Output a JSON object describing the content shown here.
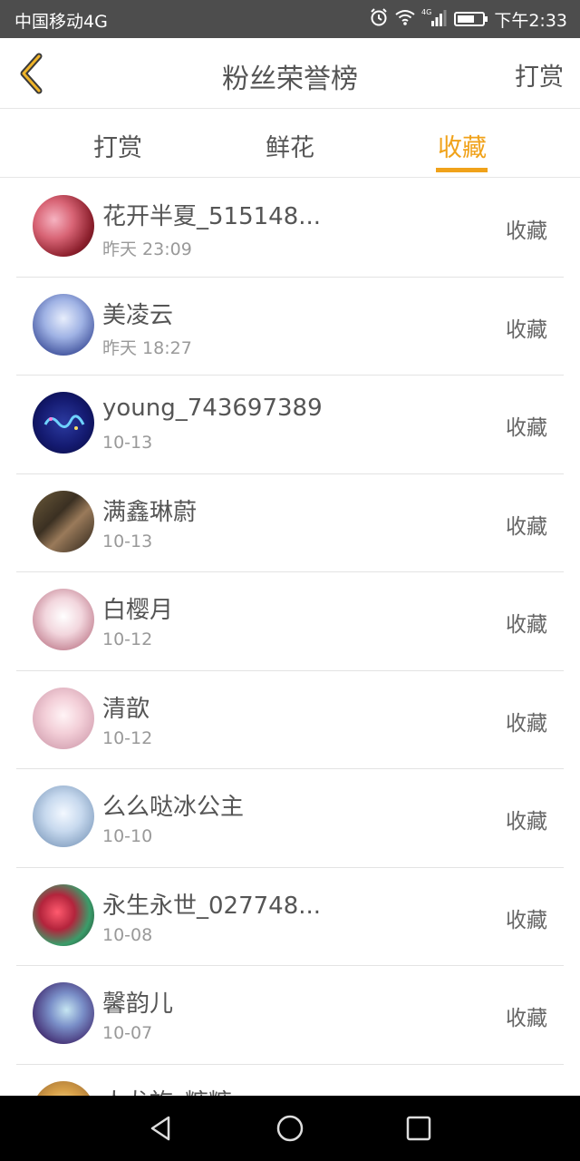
{
  "status_bar": {
    "carrier": "中国移动4G",
    "time": "下午2:33",
    "network": "4G"
  },
  "header": {
    "title": "粉丝荣誉榜",
    "action": "打赏"
  },
  "tabs": [
    {
      "label": "打赏",
      "active": false
    },
    {
      "label": "鲜花",
      "active": false
    },
    {
      "label": "收藏",
      "active": true
    }
  ],
  "colors": {
    "accent": "#f0a21a"
  },
  "list": [
    {
      "name": "花开半夏_515148...",
      "time": "昨天 23:09",
      "action": "收藏"
    },
    {
      "name": "美凌云",
      "time": "昨天 18:27",
      "action": "收藏"
    },
    {
      "name": "young_743697389",
      "time": "10-13",
      "action": "收藏"
    },
    {
      "name": "满鑫琳蔚",
      "time": "10-13",
      "action": "收藏"
    },
    {
      "name": "白樱月",
      "time": "10-12",
      "action": "收藏"
    },
    {
      "name": "清歆",
      "time": "10-12",
      "action": "收藏"
    },
    {
      "name": "么么哒冰公主",
      "time": "10-10",
      "action": "收藏"
    },
    {
      "name": "永生永世_027748...",
      "time": "10-08",
      "action": "收藏"
    },
    {
      "name": "馨韵儿",
      "time": "10-07",
      "action": "收藏"
    },
    {
      "name": "人龙族_糖糖",
      "time": "",
      "action": ""
    }
  ]
}
